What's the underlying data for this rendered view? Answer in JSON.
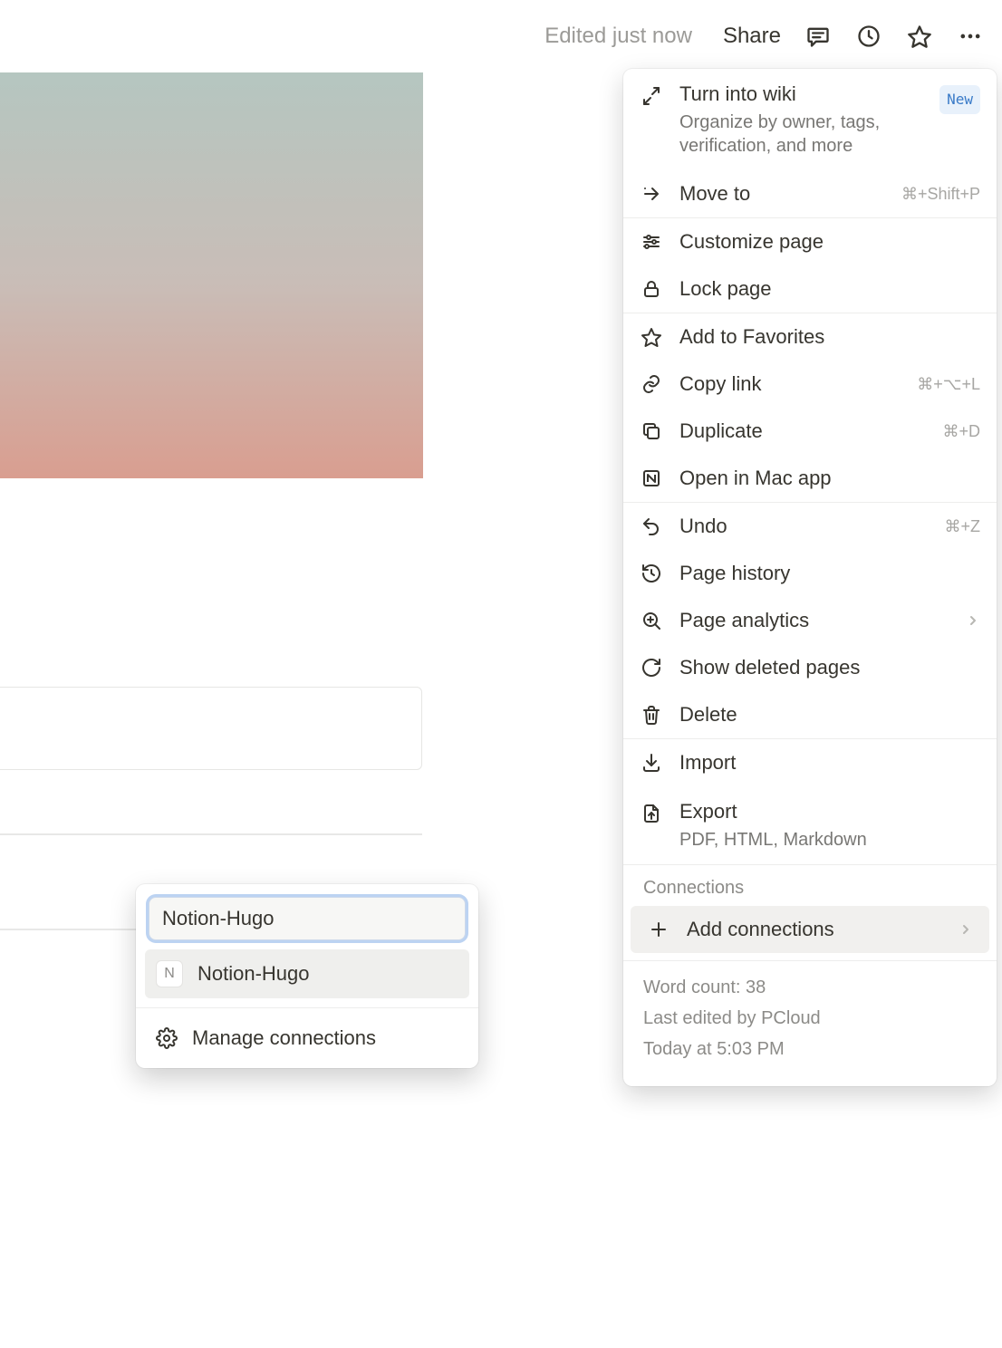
{
  "topbar": {
    "edited_label": "Edited just now",
    "share_label": "Share"
  },
  "menu": {
    "turn_wiki": {
      "label": "Turn into wiki",
      "sub": "Organize by owner, tags, verification, and more",
      "badge": "New"
    },
    "move_to": {
      "label": "Move to",
      "shortcut": "⌘+Shift+P"
    },
    "customize": {
      "label": "Customize page"
    },
    "lock": {
      "label": "Lock page"
    },
    "favorites": {
      "label": "Add to Favorites"
    },
    "copy_link": {
      "label": "Copy link",
      "shortcut": "⌘+⌥+L"
    },
    "duplicate": {
      "label": "Duplicate",
      "shortcut": "⌘+D"
    },
    "open_app": {
      "label": "Open in Mac app"
    },
    "undo": {
      "label": "Undo",
      "shortcut": "⌘+Z"
    },
    "history": {
      "label": "Page history"
    },
    "analytics": {
      "label": "Page analytics"
    },
    "deleted": {
      "label": "Show deleted pages"
    },
    "delete": {
      "label": "Delete"
    },
    "import": {
      "label": "Import"
    },
    "export": {
      "label": "Export",
      "sub": "PDF, HTML, Markdown"
    },
    "connections_header": "Connections",
    "add_connections": {
      "label": "Add connections"
    },
    "footer": {
      "word_count": "Word count: 38",
      "last_edited": "Last edited by PCloud",
      "timestamp": "Today at 5:03 PM"
    }
  },
  "connections_popover": {
    "input_value": "Notion-Hugo",
    "result_label": "Notion-Hugo",
    "result_tile": "N",
    "manage_label": "Manage connections"
  }
}
